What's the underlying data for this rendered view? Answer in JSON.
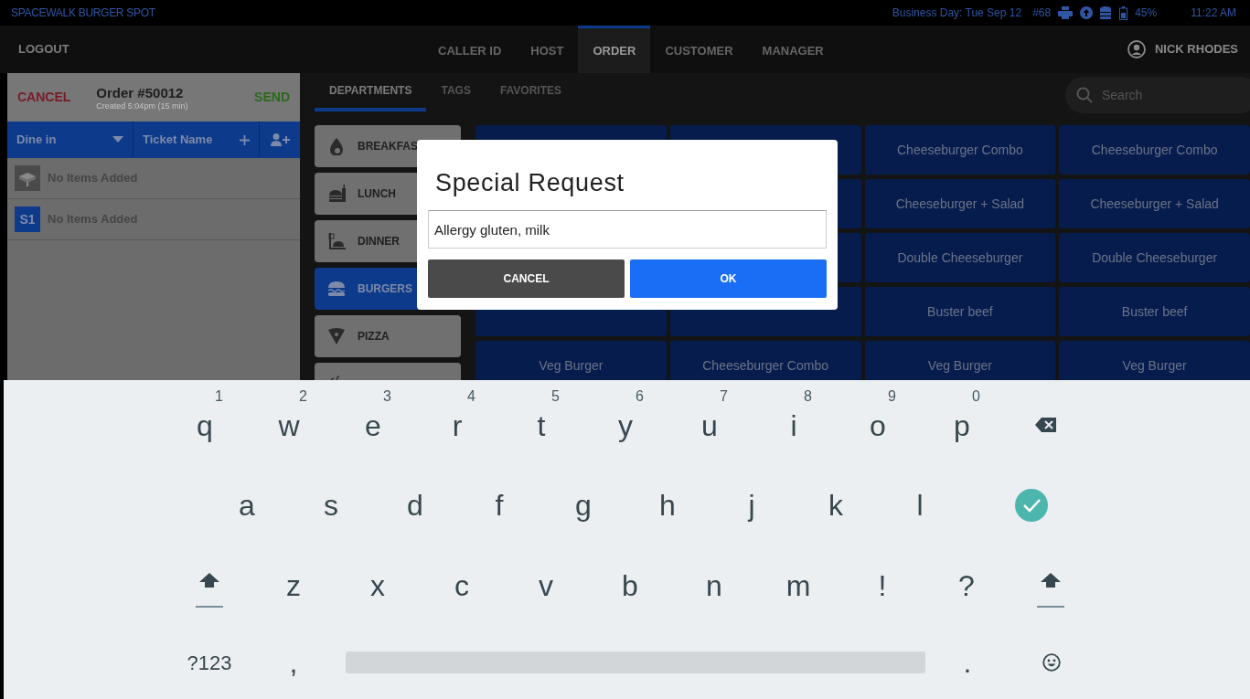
{
  "status_bar": {
    "store": "SPACEWALK BURGER SPOT",
    "business_day": "Business Day: Tue Sep 12",
    "terminal": "#68",
    "battery": "45%",
    "time": "11:22 AM"
  },
  "nav": {
    "logout": "LOGOUT",
    "tabs": [
      {
        "label": "CALLER ID",
        "selected": false
      },
      {
        "label": "HOST",
        "selected": false
      },
      {
        "label": "ORDER",
        "selected": true
      },
      {
        "label": "CUSTOMER",
        "selected": false
      },
      {
        "label": "MANAGER",
        "selected": false
      }
    ],
    "user": "NICK RHODES"
  },
  "order": {
    "cancel": "CANCEL",
    "title": "Order #50012",
    "created": "Created 5:04pm (15 min)",
    "send": "SEND",
    "service": "Dine in",
    "ticket_name": "Ticket Name",
    "seats": [
      {
        "kind": "table",
        "empty_text": "No Items Added"
      },
      {
        "kind": "seat",
        "badge": "S1",
        "empty_text": "No Items Added"
      }
    ]
  },
  "catalog": {
    "tabs": [
      {
        "label": "DEPARTMENTS",
        "selected": true
      },
      {
        "label": "TAGS",
        "selected": false
      },
      {
        "label": "FAVORITES",
        "selected": false
      }
    ],
    "search": {
      "placeholder": "Search"
    },
    "departments": [
      {
        "kind": "breakfast",
        "label": "BREAKFAS",
        "selected": false
      },
      {
        "kind": "lunch",
        "label": "LUNCH",
        "selected": false
      },
      {
        "kind": "dinner",
        "label": "DINNER",
        "selected": false
      },
      {
        "kind": "burgers",
        "label": "BURGERS",
        "selected": true
      },
      {
        "kind": "pizza",
        "label": "PIZZA",
        "selected": false
      },
      {
        "kind": "soup",
        "selected": false
      }
    ],
    "products": [
      {
        "kind": "covered"
      },
      {
        "kind": "covered"
      },
      {
        "kind": "item",
        "label": "Cheeseburger Combo"
      },
      {
        "kind": "item",
        "label": "Cheeseburger Combo"
      },
      {
        "kind": "hidden"
      },
      {
        "kind": "covered"
      },
      {
        "kind": "item",
        "label": "Cheeseburger + Salad"
      },
      {
        "kind": "item",
        "label": "Cheeseburger + Salad"
      },
      {
        "kind": "hidden"
      },
      {
        "kind": "covered"
      },
      {
        "kind": "item",
        "label": "Double Cheeseburger"
      },
      {
        "kind": "item",
        "label": "Double Cheeseburger"
      },
      {
        "kind": "covered"
      },
      {
        "kind": "covered"
      },
      {
        "kind": "item",
        "label": "Buster beef"
      },
      {
        "kind": "item",
        "label": "Buster beef"
      },
      {
        "kind": "item",
        "label": "Veg Burger"
      },
      {
        "kind": "item",
        "label": "Cheeseburger Combo"
      },
      {
        "kind": "item",
        "label": "Veg Burger"
      },
      {
        "kind": "item",
        "label": "Veg Burger"
      }
    ]
  },
  "dialog": {
    "title": "Special Request",
    "value": "Allergy gluten, milk",
    "buttons": [
      {
        "kind": "cancel",
        "label": "CANCEL"
      },
      {
        "kind": "ok",
        "label": "OK"
      }
    ]
  },
  "keyboard": {
    "rows": [
      {
        "keys": [
          {
            "kind": "char",
            "label": "q",
            "hint": "1"
          },
          {
            "kind": "char",
            "label": "w",
            "hint": "2"
          },
          {
            "kind": "char",
            "label": "e",
            "hint": "3"
          },
          {
            "kind": "char",
            "label": "r",
            "hint": "4"
          },
          {
            "kind": "char",
            "label": "t",
            "hint": "5"
          },
          {
            "kind": "char",
            "label": "y",
            "hint": "6"
          },
          {
            "kind": "char",
            "label": "u",
            "hint": "7"
          },
          {
            "kind": "char",
            "label": "i",
            "hint": "8"
          },
          {
            "kind": "char",
            "label": "o",
            "hint": "9"
          },
          {
            "kind": "char",
            "label": "p",
            "hint": "0"
          },
          {
            "kind": "backspace"
          }
        ]
      },
      {
        "keys": [
          {
            "kind": "char",
            "label": "a"
          },
          {
            "kind": "char",
            "label": "s"
          },
          {
            "kind": "char",
            "label": "d"
          },
          {
            "kind": "char",
            "label": "f"
          },
          {
            "kind": "char",
            "label": "g"
          },
          {
            "kind": "char",
            "label": "h"
          },
          {
            "kind": "char",
            "label": "j"
          },
          {
            "kind": "char",
            "label": "k"
          },
          {
            "kind": "char",
            "label": "l"
          },
          {
            "kind": "enter"
          }
        ]
      },
      {
        "keys": [
          {
            "kind": "shift"
          },
          {
            "kind": "char",
            "label": "z"
          },
          {
            "kind": "char",
            "label": "x"
          },
          {
            "kind": "char",
            "label": "c"
          },
          {
            "kind": "char",
            "label": "v"
          },
          {
            "kind": "char",
            "label": "b"
          },
          {
            "kind": "char",
            "label": "n"
          },
          {
            "kind": "char",
            "label": "m"
          },
          {
            "kind": "char",
            "label": "!"
          },
          {
            "kind": "char",
            "label": "?"
          },
          {
            "kind": "shift"
          }
        ]
      },
      {
        "keys": [
          {
            "kind": "mode",
            "label": "?123"
          },
          {
            "kind": "char",
            "label": ","
          },
          {
            "kind": "space"
          },
          {
            "kind": "char",
            "label": "."
          },
          {
            "kind": "emoji"
          }
        ]
      }
    ]
  }
}
